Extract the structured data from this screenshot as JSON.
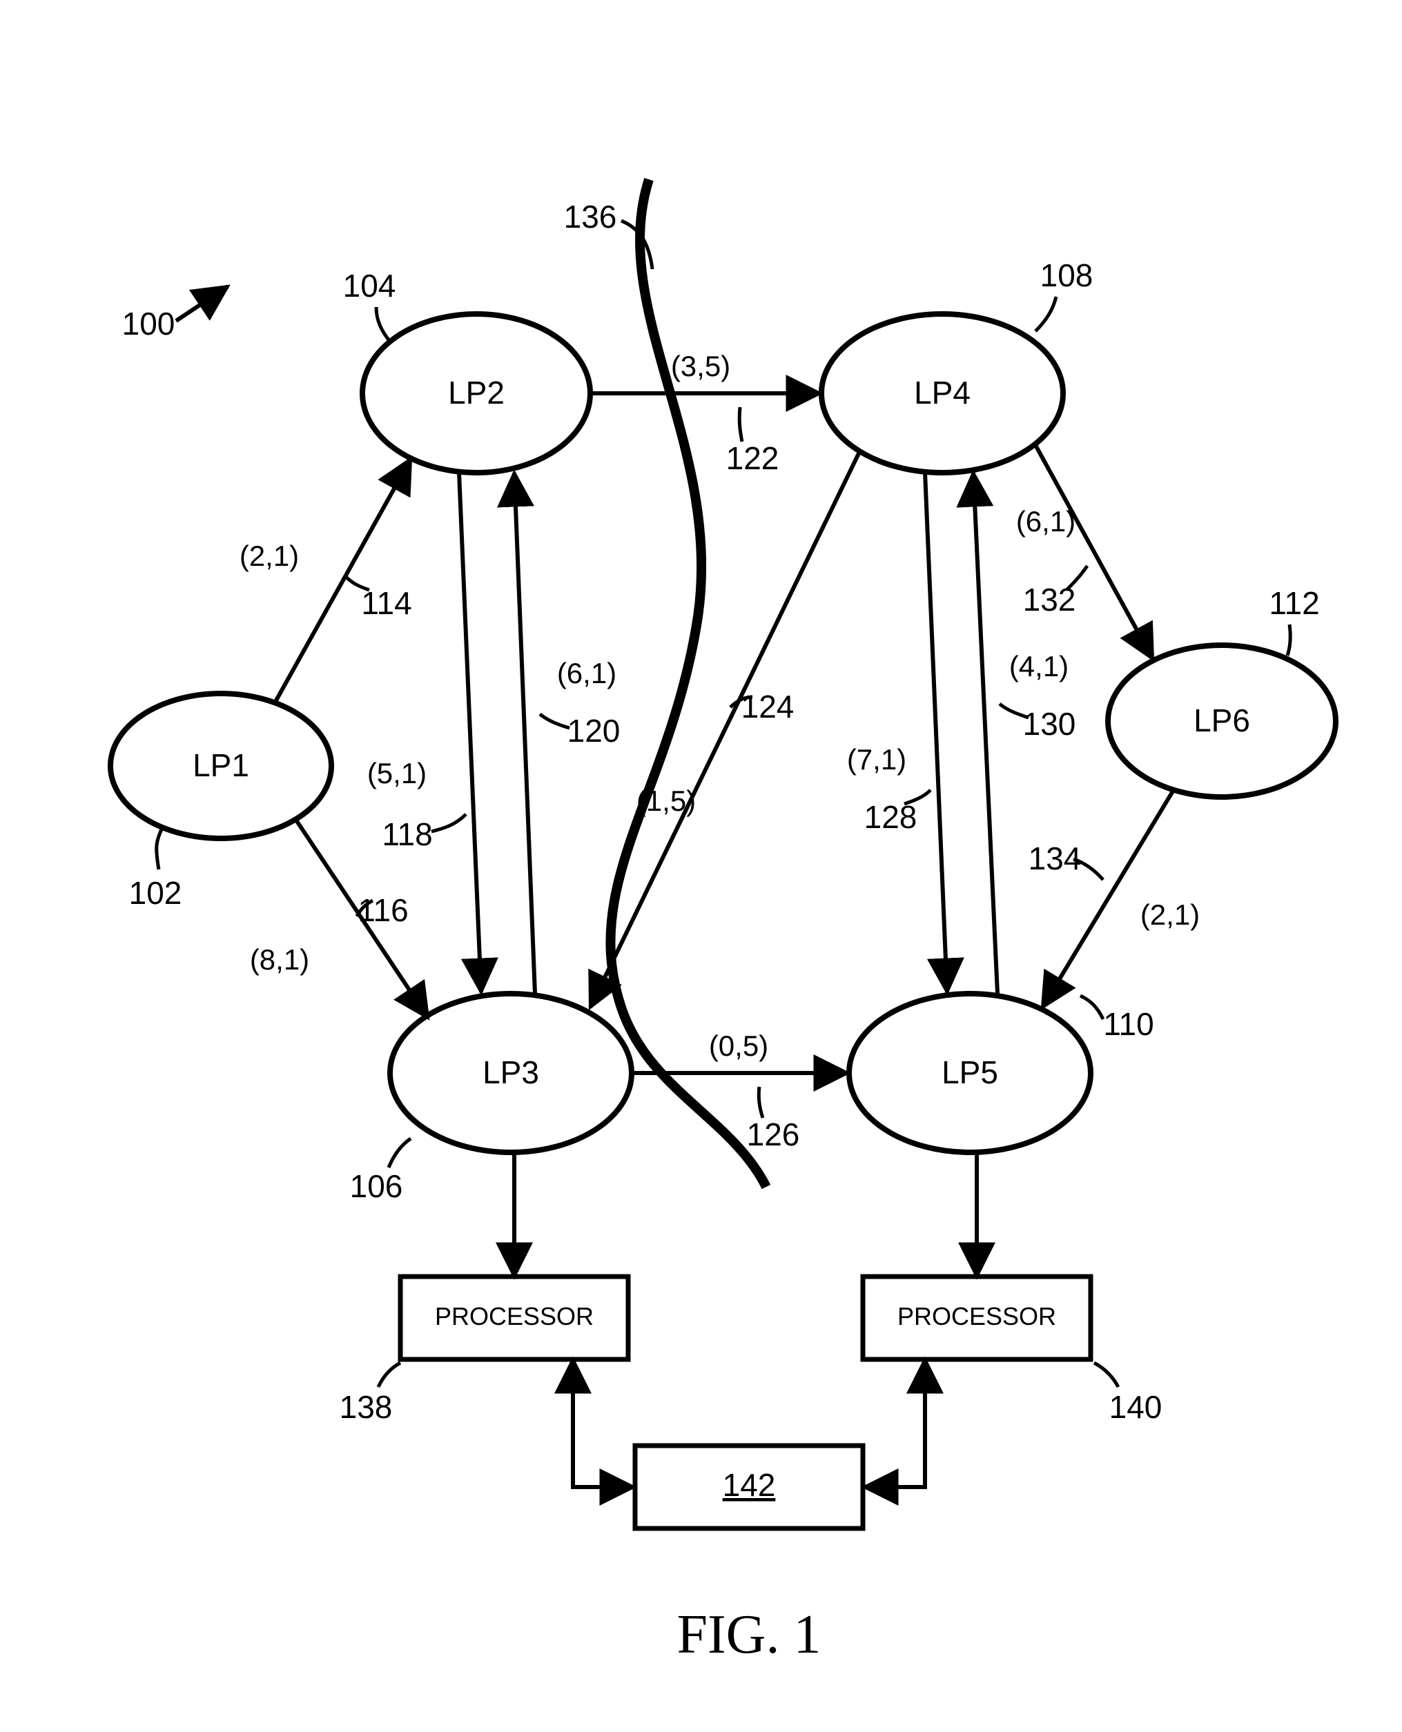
{
  "figure": {
    "title": "FIG. 1",
    "system_ref": "100"
  },
  "nodes": {
    "lp1": {
      "label": "LP1",
      "ref": "102"
    },
    "lp2": {
      "label": "LP2",
      "ref": "104"
    },
    "lp3": {
      "label": "LP3",
      "ref": "106"
    },
    "lp4": {
      "label": "LP4",
      "ref": "108"
    },
    "lp5": {
      "label": "LP5",
      "ref": "110"
    },
    "lp6": {
      "label": "LP6",
      "ref": "112"
    }
  },
  "edges": {
    "e114": {
      "label": "(2,1)",
      "ref": "114"
    },
    "e116": {
      "label": "(8,1)",
      "ref": "116"
    },
    "e118": {
      "label": "(5,1)",
      "ref": "118"
    },
    "e120": {
      "label": "(6,1)",
      "ref": "120"
    },
    "e122": {
      "label": "(3,5)",
      "ref": "122"
    },
    "e124": {
      "label": "(1,5)",
      "ref": "124"
    },
    "e126": {
      "label": "(0,5)",
      "ref": "126"
    },
    "e128": {
      "label": "(7,1)",
      "ref": "128"
    },
    "e130": {
      "label": "(4,1)",
      "ref": "130"
    },
    "e132": {
      "label": "(6,1)",
      "ref": "132"
    },
    "e134": {
      "label": "(2,1)",
      "ref": "134"
    }
  },
  "boundary": {
    "ref": "136"
  },
  "processors": {
    "p138": {
      "label": "PROCESSOR",
      "ref": "138"
    },
    "p140": {
      "label": "PROCESSOR",
      "ref": "140"
    },
    "p142": {
      "label": "",
      "ref": "142"
    }
  }
}
